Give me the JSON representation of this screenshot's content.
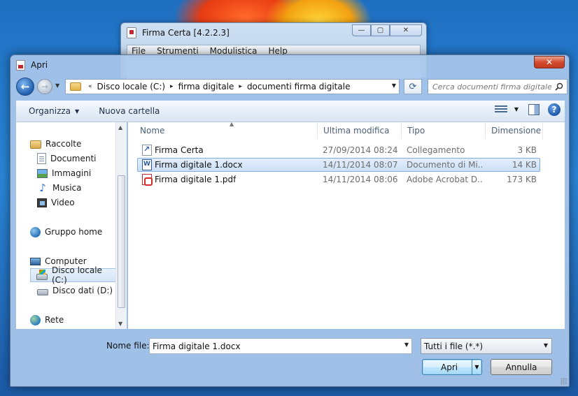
{
  "colors": {
    "accent": "#3c7fb1",
    "selection": "#cde0f6",
    "close_button": "#d44b2f"
  },
  "back_window": {
    "title": "Firma Certa [4.2.2.3]",
    "menu": [
      "File",
      "Strumenti",
      "Modulistica",
      "Help"
    ],
    "controls": {
      "minimize": "—",
      "maximize": "▢",
      "close": "✕"
    }
  },
  "dialog": {
    "title": "Apri",
    "close_glyph": "✕"
  },
  "address": {
    "overflow": "«",
    "segments": [
      "Disco locale (C:)",
      "firma digitale",
      "documenti firma digitale"
    ],
    "separator": "▸"
  },
  "search": {
    "placeholder": "Cerca documenti firma digitale"
  },
  "commands": {
    "organize": "Organizza",
    "new_folder": "Nuova cartella",
    "help": "?"
  },
  "nav": {
    "items": [
      {
        "label": "Raccolte",
        "icon": "library-icon"
      },
      {
        "label": "Documenti",
        "icon": "documents-icon"
      },
      {
        "label": "Immagini",
        "icon": "pictures-icon"
      },
      {
        "label": "Musica",
        "icon": "music-icon"
      },
      {
        "label": "Video",
        "icon": "video-icon"
      },
      {
        "label": "Gruppo home",
        "icon": "homegroup-icon"
      },
      {
        "label": "Computer",
        "icon": "computer-icon"
      },
      {
        "label": "Disco locale (C:)",
        "icon": "local-disk-icon",
        "selected": true
      },
      {
        "label": "Disco dati (D:)",
        "icon": "data-disk-icon"
      },
      {
        "label": "Rete",
        "icon": "network-icon"
      }
    ]
  },
  "columns": [
    "Nome",
    "Ultima modifica",
    "Tipo",
    "Dimensione"
  ],
  "files": [
    {
      "name": "Firma Certa",
      "date": "27/09/2014 08:24",
      "type": "Collegamento",
      "size": "3 KB",
      "icon": "shortcut-icon"
    },
    {
      "name": "Firma digitale 1.docx",
      "date": "14/11/2014 08:07",
      "type": "Documento di Mi...",
      "size": "14 KB",
      "icon": "word-document-icon",
      "selected": true
    },
    {
      "name": "Firma digitale 1.pdf",
      "date": "14/11/2014 08:06",
      "type": "Adobe Acrobat D...",
      "size": "173 KB",
      "icon": "pdf-icon"
    }
  ],
  "footer": {
    "filename_label": "Nome file:",
    "filename_value": "Firma digitale 1.docx",
    "filter": "Tutti i file (*.*)",
    "open": "Apri",
    "cancel": "Annulla"
  }
}
